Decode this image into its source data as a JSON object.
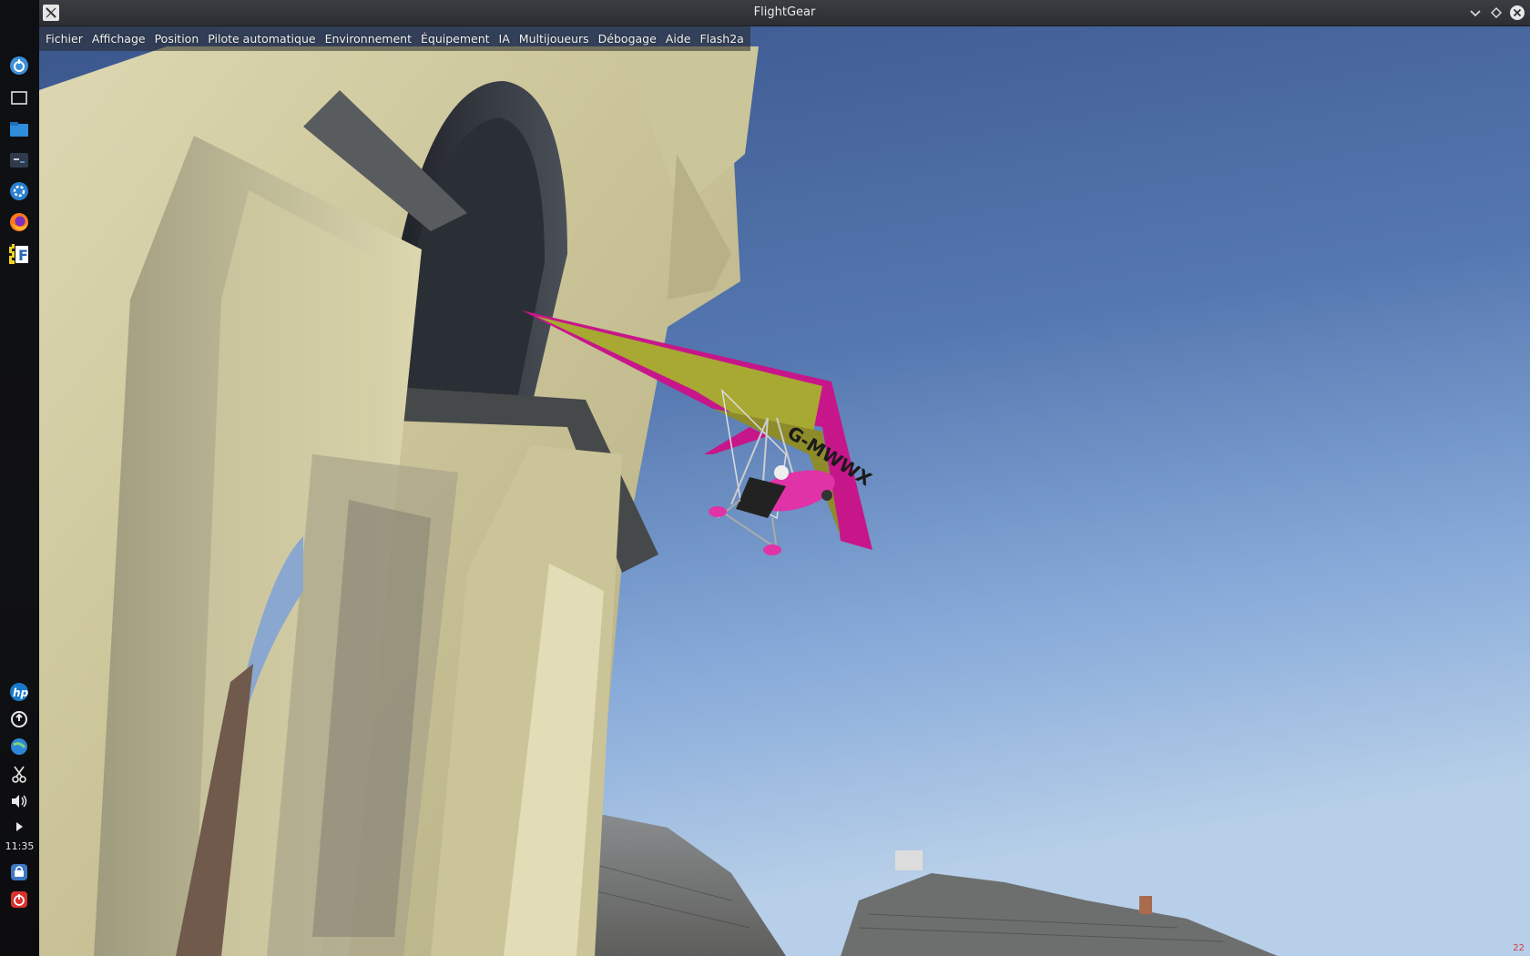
{
  "window": {
    "title": "FlightGear"
  },
  "menu": {
    "items": [
      {
        "label": "Fichier"
      },
      {
        "label": "Affichage"
      },
      {
        "label": "Position"
      },
      {
        "label": "Pilote automatique"
      },
      {
        "label": "Environnement"
      },
      {
        "label": "Équipement"
      },
      {
        "label": "IA"
      },
      {
        "label": "Multijoueurs"
      },
      {
        "label": "Débogage"
      },
      {
        "label": "Aide"
      },
      {
        "label": "Flash2a"
      }
    ]
  },
  "taskbar": {
    "clock": "11:35",
    "launchers": [
      "menu-icon",
      "desktop-icon",
      "file-manager-icon",
      "terminal-icon",
      "settings-icon",
      "firefox-icon",
      "flightgear-icon"
    ],
    "tray": [
      "hp-icon",
      "update-icon",
      "network-icon",
      "scissors-icon",
      "volume-icon",
      "arrow-icon",
      "lock-icon",
      "power-icon"
    ]
  },
  "scene": {
    "aircraft_registration": "G-MWWX",
    "frame_rate": "22"
  },
  "colors": {
    "sky_top": "#3f5b92",
    "sky_bottom": "#a9c7e6",
    "stone": "#d8d2a6",
    "wing": "#c2187a",
    "wing_top": "#a6a832"
  }
}
